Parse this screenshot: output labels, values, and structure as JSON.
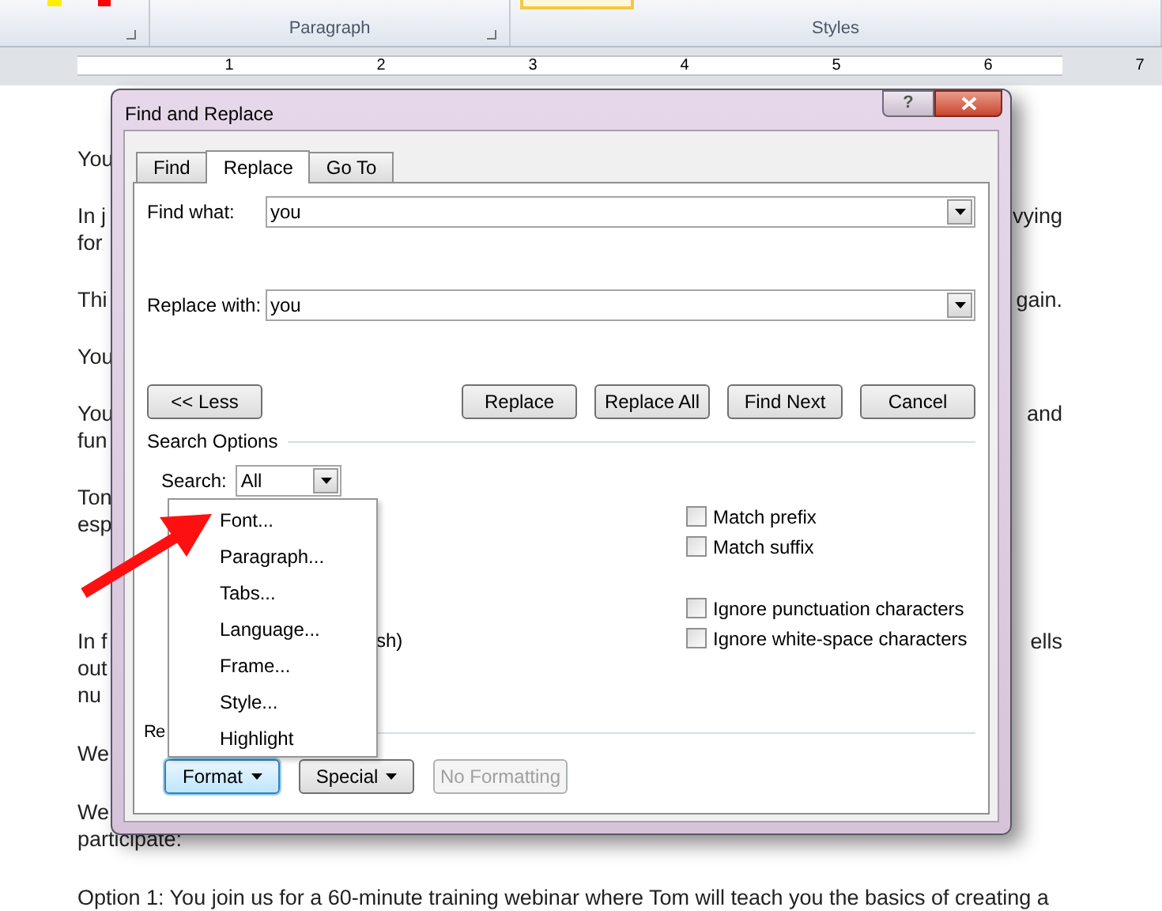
{
  "ribbon": {
    "groups": [
      {
        "label": "Paragraph",
        "launcher": true
      },
      {
        "label": "Styles",
        "launcher": false
      }
    ]
  },
  "ruler": {
    "numbers": [
      "1",
      "2",
      "3",
      "4",
      "5",
      "6",
      "7"
    ]
  },
  "document": {
    "paragraphs": [
      {
        "lines": [
          {
            "left": "You"
          }
        ]
      },
      {
        "lines": [
          {
            "left": "In j",
            "right": "vying"
          },
          {
            "left": "for"
          }
        ]
      },
      {
        "lines": [
          {
            "left": "Thi",
            "right": "gain."
          }
        ]
      },
      {
        "lines": [
          {
            "left": "You"
          }
        ]
      },
      {
        "lines": [
          {
            "left": "You",
            "right": "and"
          },
          {
            "left": "fun"
          }
        ]
      },
      {
        "lines": [
          {
            "left": "Ton"
          },
          {
            "left": "esp"
          }
        ]
      },
      {
        "lines": [
          {
            "left": "In f",
            "right": "ells"
          },
          {
            "left": "out"
          },
          {
            "left": "nu"
          }
        ]
      },
      {
        "lines": [
          {
            "left": "We"
          }
        ]
      },
      {
        "lines": [
          {
            "left": "We"
          },
          {
            "left": "participate:"
          }
        ]
      },
      {
        "lines": [
          {
            "left": "Option 1: You join us for a 60-minute training webinar where Tom will teach you the basics of creating a"
          }
        ]
      }
    ]
  },
  "dialog": {
    "title": "Find and Replace",
    "help": "?",
    "tabs": [
      {
        "label": "Find",
        "selected": false
      },
      {
        "label": "Replace",
        "selected": true
      },
      {
        "label": "Go To",
        "selected": false
      }
    ],
    "find_what": {
      "label": "Find what:",
      "value": "you"
    },
    "replace_with": {
      "label": "Replace with:",
      "value": "you"
    },
    "less_button": "<< Less",
    "action_buttons": [
      "Replace",
      "Replace All",
      "Find Next",
      "Cancel"
    ],
    "search_options": {
      "heading": "Search Options",
      "search": {
        "label": "Search:",
        "value": "All"
      },
      "partial_label": "sh)",
      "match_options": [
        {
          "label": "Match prefix",
          "checked": false
        },
        {
          "label": "Match suffix",
          "checked": false
        }
      ],
      "ignore_options": [
        {
          "label": "Ignore punctuation characters",
          "checked": false
        },
        {
          "label": "Ignore white-space characters",
          "checked": false
        }
      ]
    },
    "replace_section": {
      "heading": "Re"
    },
    "bottom_buttons": [
      {
        "label": "Format",
        "menu": true,
        "focused": true,
        "disabled": false
      },
      {
        "label": "Special",
        "menu": true,
        "focused": false,
        "disabled": false
      },
      {
        "label": "No Formatting",
        "menu": false,
        "focused": false,
        "disabled": true
      }
    ],
    "format_menu": {
      "items": [
        "Font...",
        "Paragraph...",
        "Tabs...",
        "Language...",
        "Frame...",
        "Style...",
        "Highlight"
      ]
    }
  }
}
